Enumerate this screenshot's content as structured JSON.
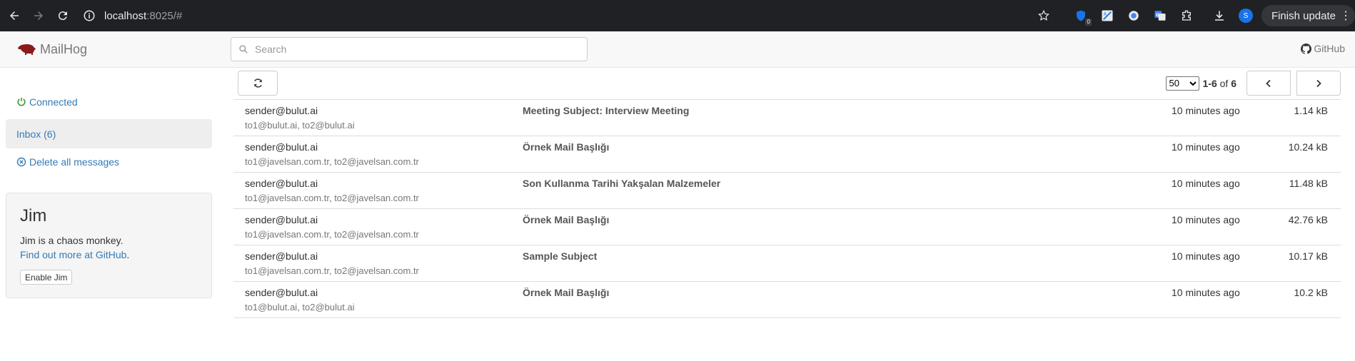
{
  "browser": {
    "url_host": "localhost",
    "url_rest": ":8025/#",
    "extension_badge": "0",
    "profile_initial": "S",
    "update_label": "Finish update"
  },
  "navbar": {
    "brand": "MailHog",
    "search_placeholder": "Search",
    "github_label": "GitHub"
  },
  "sidebar": {
    "connected_label": "Connected",
    "inbox_label": "Inbox (6)",
    "delete_label": "Delete all messages",
    "jim": {
      "title": "Jim",
      "description": "Jim is a chaos monkey.",
      "link_label": "Find out more at GitHub",
      "link_suffix": ".",
      "button_label": "Enable Jim"
    }
  },
  "toolbar": {
    "per_page_selected": "50",
    "range_bold": "1-6",
    "range_of": " of ",
    "total_bold": "6"
  },
  "messages": [
    {
      "from": "sender@bulut.ai",
      "to": "to1@bulut.ai, to2@bulut.ai",
      "subject": "Meeting Subject: Interview Meeting",
      "time": "10 minutes ago",
      "size": "1.14 kB"
    },
    {
      "from": "sender@bulut.ai",
      "to": "to1@javelsan.com.tr, to2@javelsan.com.tr",
      "subject": "Örnek Mail Başlığı",
      "time": "10 minutes ago",
      "size": "10.24 kB"
    },
    {
      "from": "sender@bulut.ai",
      "to": "to1@javelsan.com.tr, to2@javelsan.com.tr",
      "subject": "Son Kullanma Tarihi Yakşalan Malzemeler",
      "time": "10 minutes ago",
      "size": "11.48 kB"
    },
    {
      "from": "sender@bulut.ai",
      "to": "to1@javelsan.com.tr, to2@javelsan.com.tr",
      "subject": "Örnek Mail Başlığı",
      "time": "10 minutes ago",
      "size": "42.76 kB"
    },
    {
      "from": "sender@bulut.ai",
      "to": "to1@javelsan.com.tr, to2@javelsan.com.tr",
      "subject": "Sample Subject",
      "time": "10 minutes ago",
      "size": "10.17 kB"
    },
    {
      "from": "sender@bulut.ai",
      "to": "to1@bulut.ai, to2@bulut.ai",
      "subject": "Örnek Mail Başlığı",
      "time": "10 minutes ago",
      "size": "10.2 kB"
    }
  ],
  "colors": {
    "chrome_bg": "#202124",
    "link": "#337ab7",
    "connected_green": "#3c9a3c",
    "brand_pig": "#8b1a1a"
  }
}
